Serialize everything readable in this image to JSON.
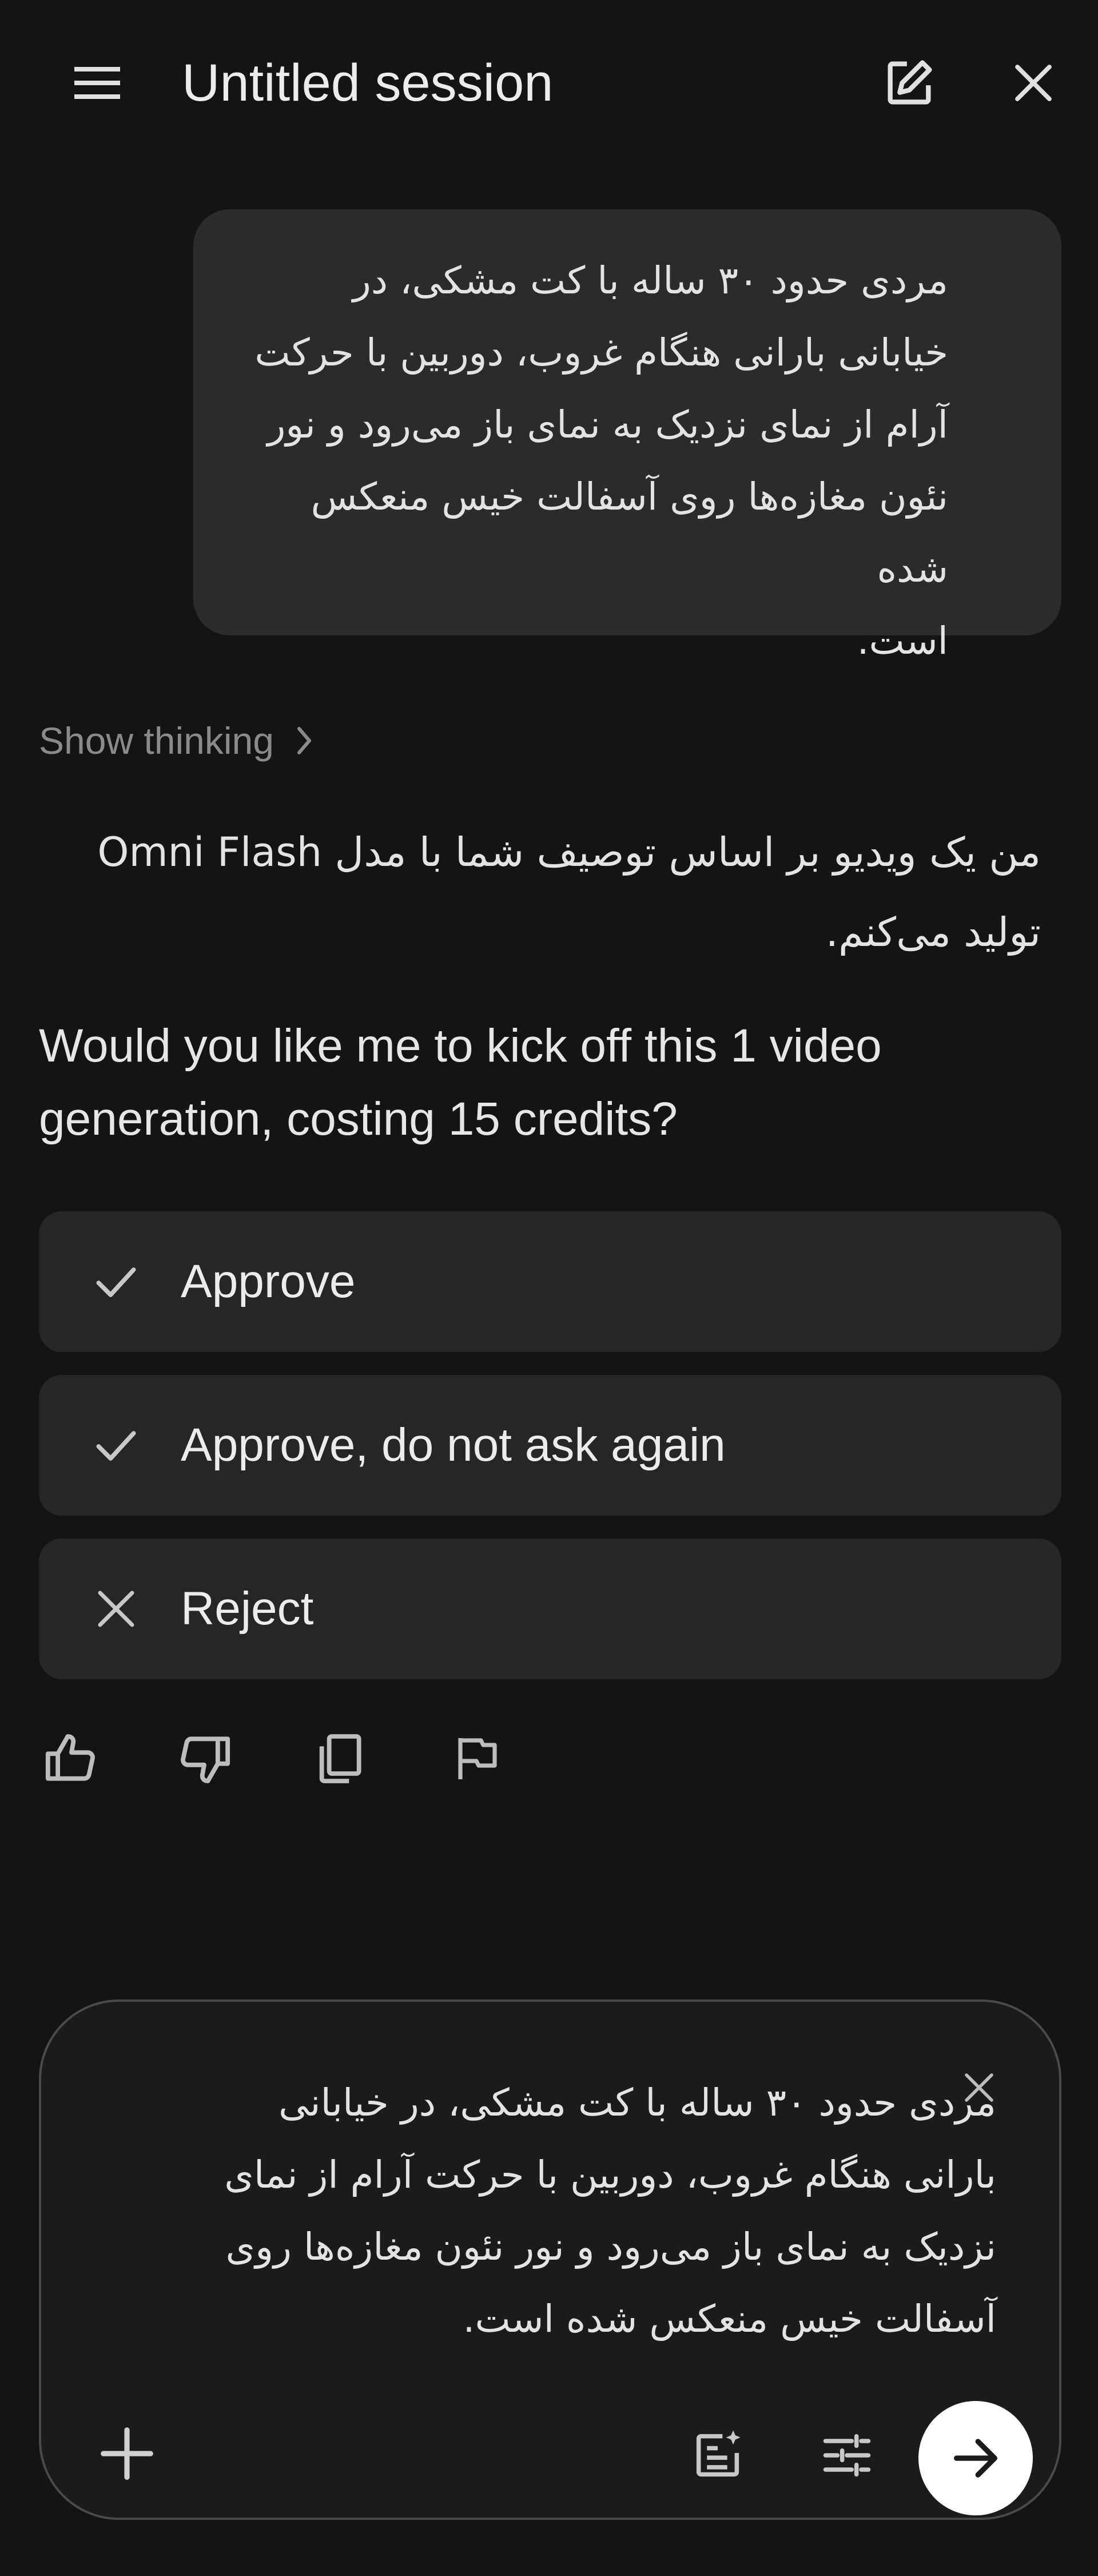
{
  "header": {
    "title": "Untitled session",
    "menu_icon": "menu-icon",
    "edit_icon": "edit-icon",
    "close_icon": "close-icon"
  },
  "user_message": {
    "lines": [
      "مردی حدود ۳۰ ساله با کت مشکی، در",
      "خیابانی بارانی هنگام غروب، دوربین با حرکت",
      "آرام از نمای نزدیک به نمای باز می‌رود و نور",
      "نئون مغازه‌ها روی آسفالت خیس منعکس شده",
      "است."
    ]
  },
  "thinking": {
    "label": "Show thinking",
    "icon": "chevron-right-icon"
  },
  "assistant": {
    "fa_line_1": "من یک ویدیو بر اساس توصیف شما با مدل Omni Flash",
    "fa_line_2": "تولید می‌کنم.",
    "en_text": "Would you like me to kick off this 1 video generation, costing 15 credits?"
  },
  "options": [
    {
      "label": "Approve",
      "icon": "check-icon"
    },
    {
      "label": "Approve, do not ask again",
      "icon": "check-icon"
    },
    {
      "label": "Reject",
      "icon": "close-icon"
    }
  ],
  "feedback": {
    "icons": [
      "thumbs-up-icon",
      "thumbs-down-icon",
      "copy-icon",
      "flag-icon"
    ]
  },
  "composer": {
    "lines": [
      "مردی حدود ۳۰ ساله با کت مشکی، در خیابانی",
      "بارانی هنگام غروب، دوربین با حرکت آرام از نمای",
      "نزدیک به نمای باز می‌رود و نور نئون مغازه‌ها روی",
      "آسفالت خیس منعکس شده است."
    ],
    "clear_icon": "close-icon",
    "add_icon": "plus-icon",
    "prompt_icon": "notes-sparkle-icon",
    "settings_icon": "tune-icon",
    "send_icon": "arrow-right-icon"
  },
  "colors": {
    "background": "#141414",
    "bubble": "#2b2b2b",
    "card": "#262626",
    "send_button": "#ffffff"
  }
}
